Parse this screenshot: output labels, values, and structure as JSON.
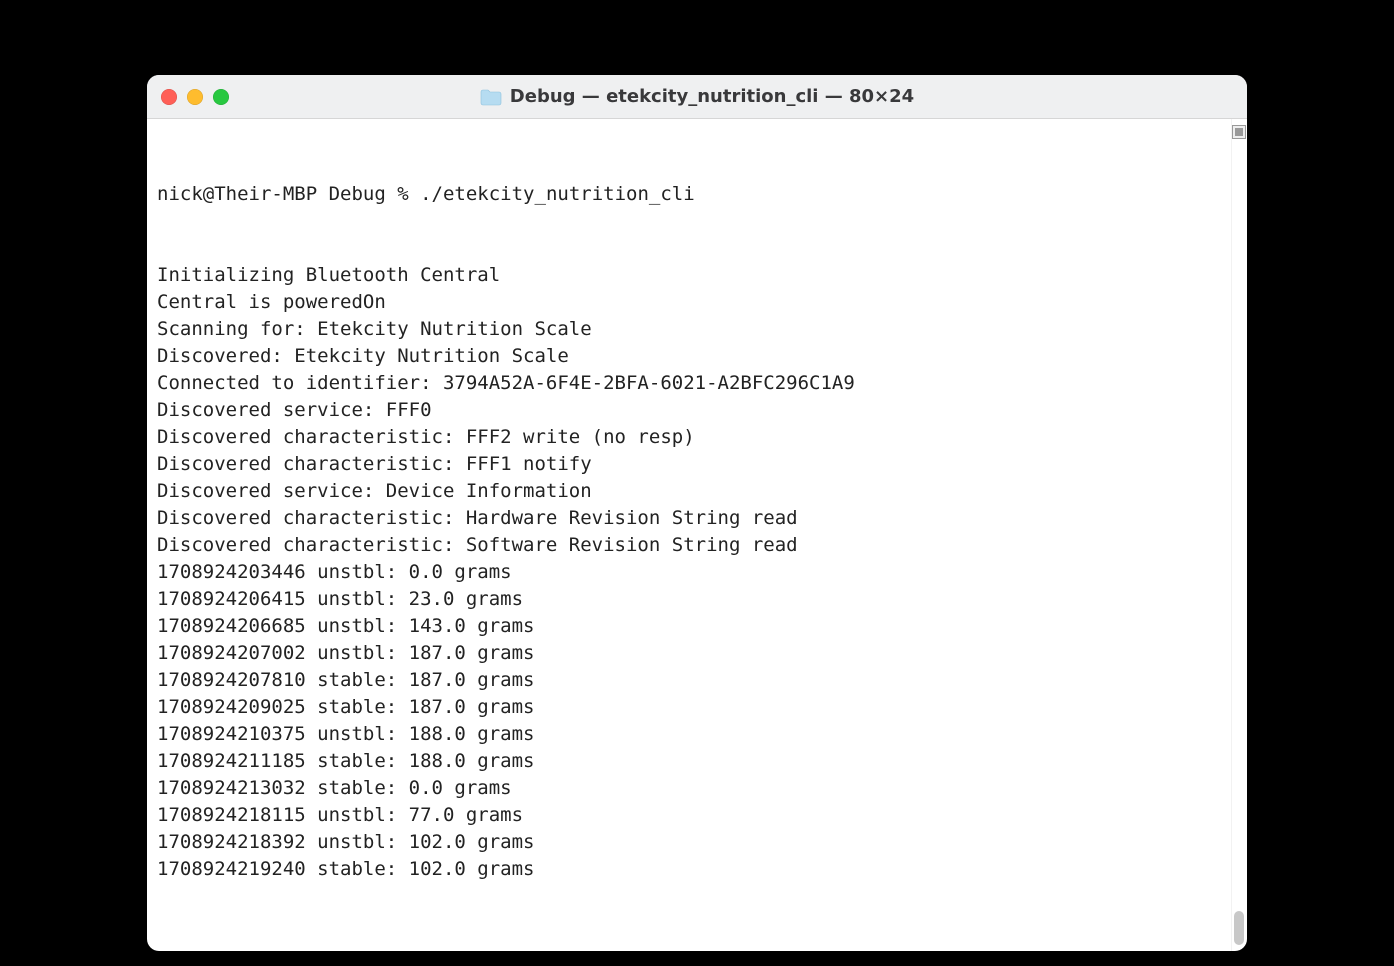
{
  "window": {
    "title": "Debug — etekcity_nutrition_cli — 80×24",
    "folder_icon": "folder"
  },
  "terminal": {
    "prompt": "nick@Their-MBP Debug % ",
    "command": "./etekcity_nutrition_cli",
    "lines": [
      "Initializing Bluetooth Central",
      "Central is poweredOn",
      "Scanning for: Etekcity Nutrition Scale",
      "Discovered: Etekcity Nutrition Scale",
      "Connected to identifier: 3794A52A-6F4E-2BFA-6021-A2BFC296C1A9",
      "Discovered service: FFF0",
      "Discovered characteristic: FFF2 write (no resp)",
      "Discovered characteristic: FFF1 notify",
      "Discovered service: Device Information",
      "Discovered characteristic: Hardware Revision String read",
      "Discovered characteristic: Software Revision String read",
      "1708924203446 unstbl: 0.0 grams",
      "1708924206415 unstbl: 23.0 grams",
      "1708924206685 unstbl: 143.0 grams",
      "1708924207002 unstbl: 187.0 grams",
      "1708924207810 stable: 187.0 grams",
      "1708924209025 stable: 187.0 grams",
      "1708924210375 unstbl: 188.0 grams",
      "1708924211185 stable: 188.0 grams",
      "1708924213032 stable: 0.0 grams",
      "1708924218115 unstbl: 77.0 grams",
      "1708924218392 unstbl: 102.0 grams",
      "1708924219240 stable: 102.0 grams"
    ]
  }
}
